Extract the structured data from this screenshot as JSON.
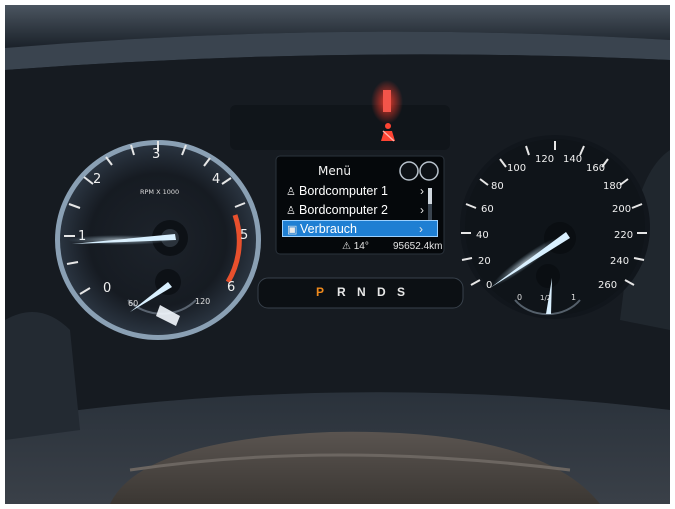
{
  "tachometer": {
    "unit_label": "RPM X 1000",
    "scale": [
      "0",
      "1",
      "2",
      "3",
      "4",
      "5",
      "6"
    ],
    "temp_gauge_labels": [
      "60",
      "120"
    ]
  },
  "speedometer": {
    "scale": [
      "0",
      "20",
      "40",
      "60",
      "80",
      "100",
      "120",
      "140",
      "160",
      "180",
      "200",
      "220",
      "240",
      "260"
    ],
    "fuel_gauge_labels": [
      "0",
      "1/2",
      "1"
    ]
  },
  "display": {
    "title": "Menü",
    "items": [
      {
        "label": "Bordcomputer 1",
        "icon": "seat-icon"
      },
      {
        "label": "Bordcomputer 2",
        "icon": "seat-icon"
      },
      {
        "label": "Verbrauch",
        "icon": "fuel-pump-icon",
        "selected": true
      }
    ],
    "outside_temp": "14°",
    "odometer": "95652.4km"
  },
  "gear_selector": {
    "gears": [
      "P",
      "R",
      "N",
      "D",
      "S"
    ],
    "active": "P",
    "active_color": "#f08a1c"
  },
  "warning_light": {
    "name": "seatbelt-warning-icon",
    "color": "#e52d1e"
  },
  "colors": {
    "needle": "#bfe6ff",
    "redline": "#e8502d",
    "highlight": "#1f7fd3"
  }
}
